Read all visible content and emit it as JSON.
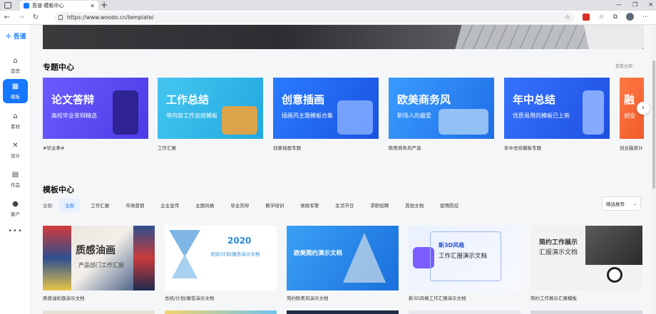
{
  "browser": {
    "tab_title": "吾道-模板中心",
    "new_tab": "+",
    "url": "https://www.woodo.cn/template/"
  },
  "sidebar": {
    "logo": "吾道",
    "items": [
      {
        "label": "首页",
        "icon": "home-icon"
      },
      {
        "label": "模板",
        "icon": "template-grid-icon"
      },
      {
        "label": "素材",
        "icon": "material-icon"
      },
      {
        "label": "设计",
        "icon": "design-icon"
      },
      {
        "label": "作品",
        "icon": "works-icon"
      },
      {
        "label": "客户",
        "icon": "customer-icon"
      }
    ],
    "more": "•••"
  },
  "topics": {
    "title": "专题中心",
    "see_all": "查看全部",
    "cards": [
      {
        "headline": "论文答辩",
        "sub": "高校毕业答辩精选",
        "label": "#毕业季#",
        "color": "#5b4cf0"
      },
      {
        "headline": "工作总结",
        "sub": "带内容工作总结模板",
        "label": "工作汇报",
        "color": "#2fb6e8"
      },
      {
        "headline": "创意插画",
        "sub": "插画风主题模板合集",
        "label": "创意插画专题",
        "color": "#1f6bf2"
      },
      {
        "headline": "欧美商务风",
        "sub": "职场人的最爱",
        "label": "欧美商务风严选",
        "color": "#2c8cf0"
      },
      {
        "headline": "年中总结",
        "sub": "优质易用的模板已上新",
        "label": "年中总结模板专题",
        "color": "#2a62f0"
      },
      {
        "headline": "融",
        "sub": "创业",
        "label": "创业融资计",
        "color": "#f46b3b"
      }
    ]
  },
  "templates": {
    "title": "模板中心",
    "filter_label": "全部:",
    "filters": [
      "全部",
      "工作汇报",
      "市场营销",
      "企业宣传",
      "主题风格",
      "毕业答辩",
      "教学培训",
      "党政军警",
      "生活节日",
      "求职招聘",
      "其他文档",
      "疫情防控"
    ],
    "sort": "精选推荐",
    "cards": [
      {
        "label": "质感油彩画演示文档",
        "big": "质感油画",
        "small": "产品部门工作汇报"
      },
      {
        "label": "总结/计划/报告演示文档",
        "big": "2020",
        "small": "总结/计划/报告演示文档"
      },
      {
        "label": "简约欧美风演示文档",
        "big": "欧美简约演示文档",
        "small": ""
      },
      {
        "label": "新3D风格工作汇报演示文档",
        "big": "新3D风格",
        "small": "工作汇报演示文档"
      },
      {
        "label": "简约工作展示汇报模板",
        "big": "简约工作展示",
        "small": "汇报演示文档"
      }
    ]
  }
}
